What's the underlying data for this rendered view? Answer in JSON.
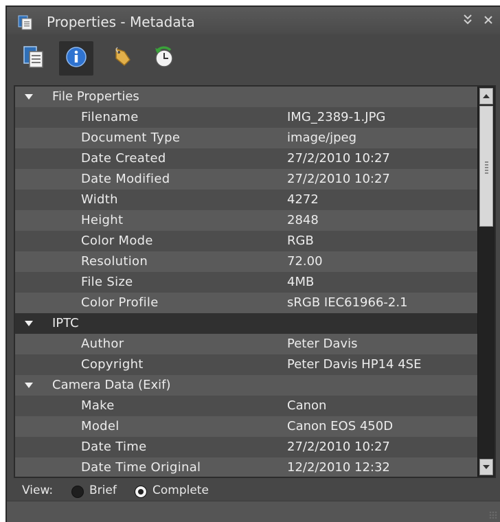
{
  "window": {
    "title": "Properties - Metadata",
    "icon": "properties-icon",
    "controls": [
      "collapse-icon",
      "close-icon"
    ]
  },
  "toolbar": {
    "buttons": [
      {
        "name": "general-tab",
        "icon": "document-icon"
      },
      {
        "name": "metadata-tab",
        "icon": "info-icon",
        "active": true
      },
      {
        "name": "keywords-tab",
        "icon": "tag-icon"
      },
      {
        "name": "history-tab",
        "icon": "history-icon"
      }
    ]
  },
  "sections": [
    {
      "title": "File Properties",
      "rows": [
        {
          "key": "Filename",
          "value": "IMG_2389-1.JPG"
        },
        {
          "key": "Document Type",
          "value": "image/jpeg"
        },
        {
          "key": "Date Created",
          "value": "27/2/2010 10:27"
        },
        {
          "key": "Date Modified",
          "value": "27/2/2010 10:27"
        },
        {
          "key": "Width",
          "value": "4272"
        },
        {
          "key": "Height",
          "value": "2848"
        },
        {
          "key": "Color Mode",
          "value": "RGB"
        },
        {
          "key": "Resolution",
          "value": "72.00"
        },
        {
          "key": "File Size",
          "value": "4MB"
        },
        {
          "key": "Color Profile",
          "value": "sRGB IEC61966-2.1"
        }
      ]
    },
    {
      "title": "IPTC",
      "rows": [
        {
          "key": "Author",
          "value": "Peter Davis"
        },
        {
          "key": "Copyright",
          "value": "Peter Davis HP14 4SE"
        }
      ]
    },
    {
      "title": "Camera Data (Exif)",
      "rows": [
        {
          "key": "Make",
          "value": "Canon"
        },
        {
          "key": "Model",
          "value": "Canon EOS 450D"
        },
        {
          "key": "Date Time",
          "value": "27/2/2010 10:27"
        },
        {
          "key": "Date Time Original",
          "value": "12/2/2010 12:32"
        }
      ]
    }
  ],
  "view": {
    "label": "View:",
    "options": [
      {
        "label": "Brief",
        "checked": false
      },
      {
        "label": "Complete",
        "checked": true
      }
    ]
  }
}
